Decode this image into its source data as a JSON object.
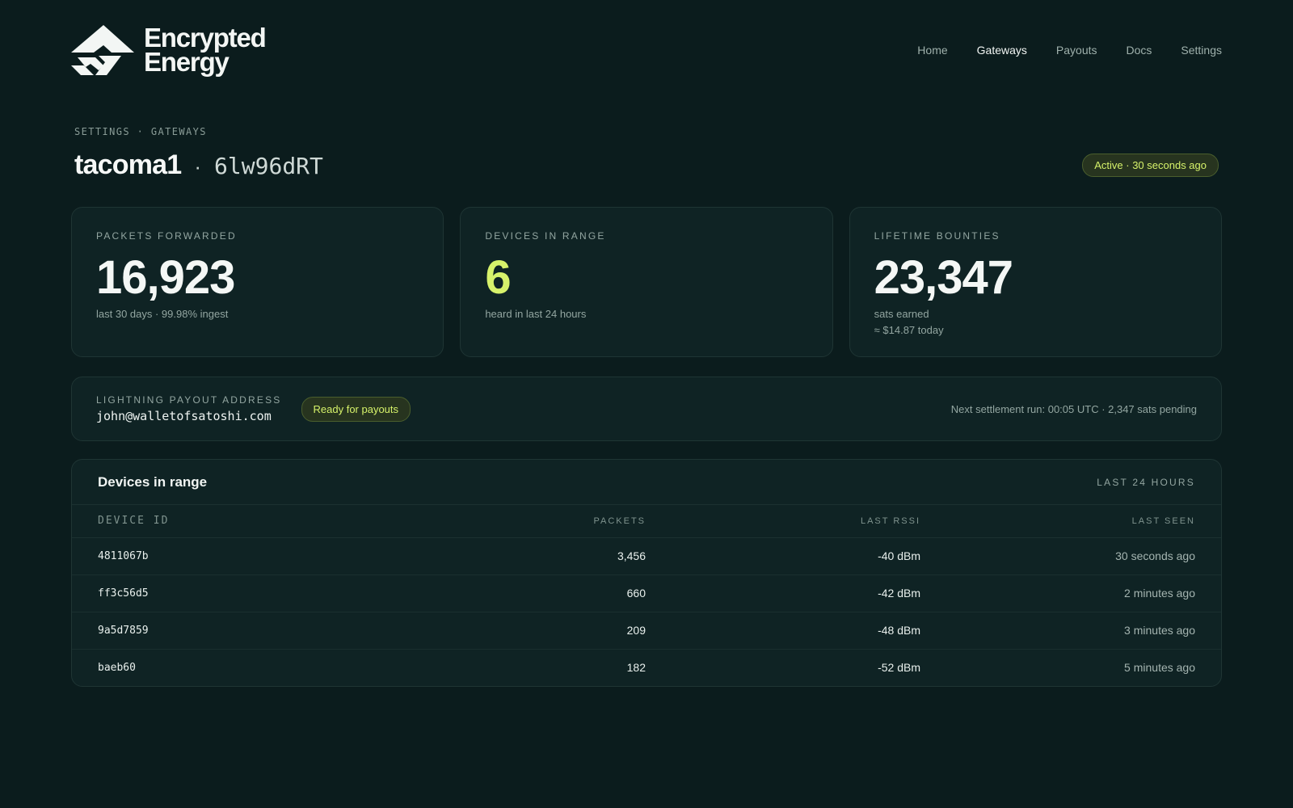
{
  "brand": {
    "line1": "Encrypted",
    "line2": "Energy",
    "logo_icon": "encrypted-energy-logo-icon"
  },
  "nav": [
    {
      "label": "Home",
      "active": false
    },
    {
      "label": "Gateways",
      "active": true
    },
    {
      "label": "Payouts",
      "active": false
    },
    {
      "label": "Docs",
      "active": false
    },
    {
      "label": "Settings",
      "active": false
    }
  ],
  "breadcrumb": "SETTINGS · GATEWAYS",
  "gateway": {
    "name": "tacoma1",
    "separator": "·",
    "id": "6lw96dRT"
  },
  "status": {
    "label": "Active · 30 seconds ago"
  },
  "stats": [
    {
      "label": "PACKETS FORWARDED",
      "value": "16,923",
      "sub1": "last 30 days · 99.98% ingest",
      "sub2": ""
    },
    {
      "label": "DEVICES IN RANGE",
      "value": "6",
      "sub1": "heard in last 24 hours",
      "sub2": ""
    },
    {
      "label": "LIFETIME BOUNTIES",
      "value": "23,347",
      "sub1": "sats earned",
      "sub2": "≈ $14.87 today"
    }
  ],
  "payout": {
    "label": "LIGHTNING PAYOUT ADDRESS",
    "address": "john@walletofsatoshi.com",
    "badge": "Ready for payouts",
    "next_run": "Next settlement run: 00:05 UTC · 2,347 sats pending"
  },
  "devices": {
    "title": "Devices in range",
    "range": "LAST 24 HOURS",
    "columns": {
      "id": "DEVICE ID",
      "packets": "PACKETS",
      "rssi": "LAST RSSI",
      "seen": "LAST SEEN"
    },
    "rows": [
      {
        "id": "4811067b",
        "packets": "3,456",
        "rssi": "-40 dBm",
        "seen": "30 seconds ago"
      },
      {
        "id": "ff3c56d5",
        "packets": "660",
        "rssi": "-42 dBm",
        "seen": "2 minutes ago"
      },
      {
        "id": "9a5d7859",
        "packets": "209",
        "rssi": "-48 dBm",
        "seen": "3 minutes ago"
      },
      {
        "id": "baeb60",
        "packets": "182",
        "rssi": "-52 dBm",
        "seen": "5 minutes ago"
      }
    ]
  },
  "colors": {
    "background": "#0b1c1d",
    "accent": "#d7f26b",
    "card": "#0f2324"
  }
}
